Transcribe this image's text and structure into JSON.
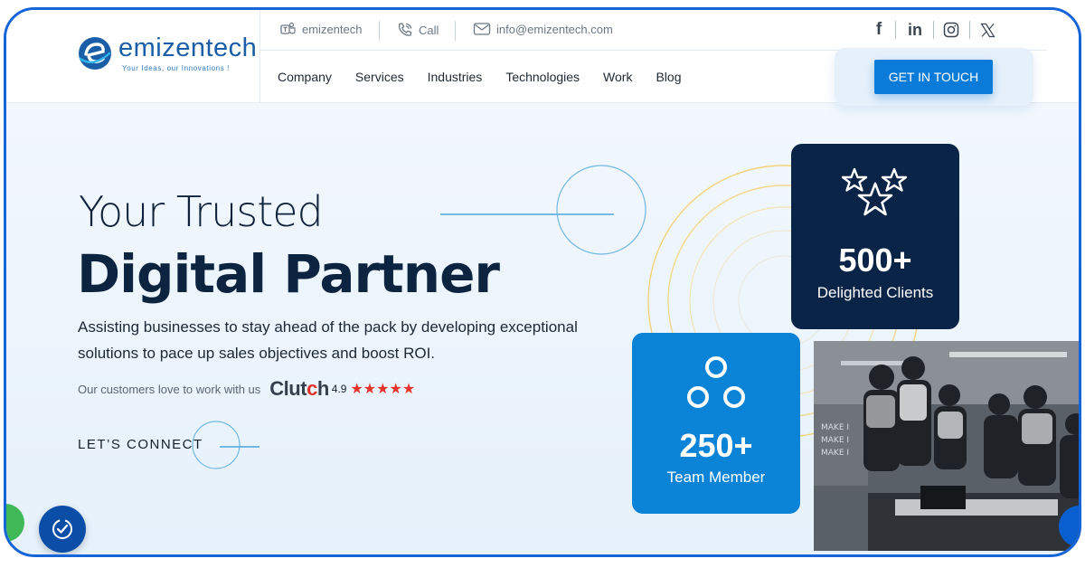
{
  "brand": {
    "name": "emizentech",
    "tagline": "Your Ideas, our Innovations !"
  },
  "topbar": {
    "teams_label": "emizentech",
    "call_label": "Call",
    "email_label": "info@emizentech.com",
    "social_icons": [
      "facebook-icon",
      "linkedin-icon",
      "instagram-icon",
      "x-icon"
    ]
  },
  "nav": {
    "items": [
      "Company",
      "Services",
      "Industries",
      "Technologies",
      "Work",
      "Blog"
    ],
    "cta_label": "GET IN TOUCH"
  },
  "hero": {
    "title_light": "Your Trusted",
    "title_bold": "Digital Partner",
    "description": "Assisting businesses to stay ahead of the pack by developing exceptional solutions to pace up sales objectives and boost ROI.",
    "clutch_text": "Our customers love to work with us",
    "clutch_brand": "Clutch",
    "clutch_rating": "4.9",
    "stars": "★★★★★",
    "connect_label": "LET’S CONNECT"
  },
  "stats": {
    "clients": {
      "number": "500+",
      "label": "Delighted Clients"
    },
    "team": {
      "number": "250+",
      "label": "Team Member"
    }
  },
  "colors": {
    "primary_blue": "#0b83d6",
    "navy": "#0a2447",
    "star_red": "#e8322c",
    "border_blue": "#1565d8"
  }
}
